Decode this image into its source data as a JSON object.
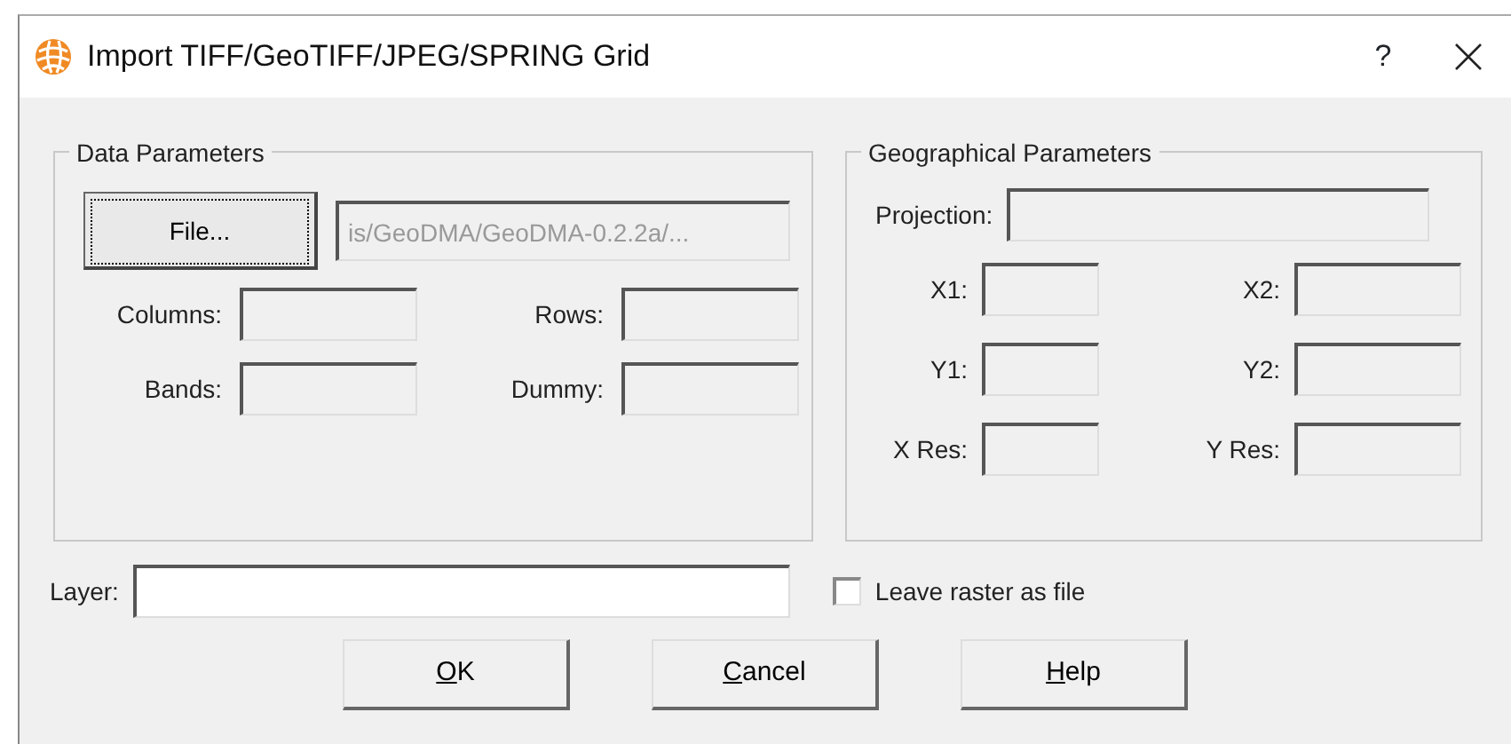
{
  "window": {
    "title": "Import TIFF/GeoTIFF/JPEG/SPRING Grid",
    "help": "?"
  },
  "data_parameters": {
    "title": "Data Parameters",
    "file_button": {
      "label": "File...",
      "focused": true
    },
    "file_path": {
      "value": "is/GeoDMA/GeoDMA-0.2.2a/...",
      "disabled": true
    },
    "fields": [
      {
        "label": "Columns:",
        "disabled": true
      },
      {
        "label": "Rows:",
        "disabled": true
      },
      {
        "label": "Bands:",
        "disabled": true
      },
      {
        "label": "Dummy:",
        "disabled": true
      }
    ]
  },
  "geographical_parameters": {
    "title": "Geographical Parameters",
    "projection": {
      "label": "Projection:",
      "disabled": true
    },
    "fields": [
      {
        "label": "X1:",
        "disabled": true
      },
      {
        "label": "X2:",
        "disabled": true
      },
      {
        "label": "Y1:",
        "disabled": true
      },
      {
        "label": "Y2:",
        "disabled": true
      },
      {
        "label": "X Res:",
        "disabled": true
      },
      {
        "label": "Y Res:",
        "disabled": true
      }
    ]
  },
  "layer": {
    "label": "Layer:",
    "disabled": false
  },
  "leave_raster": {
    "label": "Leave raster as file",
    "checked": false
  },
  "buttons": [
    {
      "label": "**O**K"
    },
    {
      "label": "**C**ancel"
    },
    {
      "label": "**H**elp"
    }
  ]
}
